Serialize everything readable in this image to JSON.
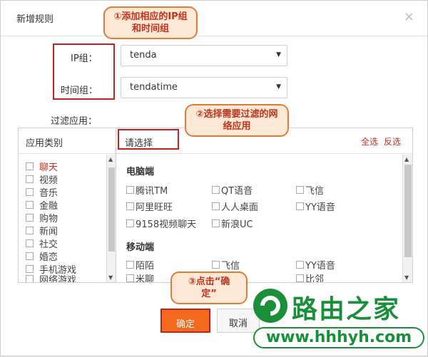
{
  "dialog": {
    "title": "新增规则",
    "close_glyph": "×"
  },
  "form": {
    "ip_group_label": "IP组：",
    "ip_group_value": "tenda",
    "time_group_label": "时间组：",
    "time_group_value": "tendatime",
    "filter_label": "过滤应用："
  },
  "callouts": {
    "step1_line1": "①添加相应的IP组",
    "step1_line2": "和时间组",
    "step2_line1": "②选择需要过滤的网",
    "step2_line2": "络应用",
    "step3_line1": "③点击“确",
    "step3_line2": "定”"
  },
  "left_panel": {
    "header": "应用类别",
    "categories": [
      "聊天",
      "视频",
      "音乐",
      "金融",
      "购物",
      "新闻",
      "社交",
      "婚恋",
      "手机游戏",
      "网络游戏"
    ]
  },
  "right_panel": {
    "header": "请选择",
    "select_all": "全选",
    "invert": "反选",
    "pc_title": "电脑端",
    "pc_apps": [
      "腾讯TM",
      "QT语音",
      "飞信",
      "阿里旺旺",
      "人人桌面",
      "YY语音",
      "9158视频聊天",
      "新浪UC"
    ],
    "mobile_title": "移动端",
    "mobile_apps": [
      "陌陌",
      "飞信",
      "YY语音",
      "米聊",
      "",
      "比邻"
    ]
  },
  "buttons": {
    "ok": "确定",
    "cancel": "取消"
  },
  "watermark": {
    "brand": "路由之家",
    "url": "www.hhhyh.com"
  },
  "colors": {
    "accent": "#f26b1d",
    "highlight_red": "#c5221f",
    "callout_bg": "#fde8d6",
    "brand_green": "#1a8f3a"
  }
}
